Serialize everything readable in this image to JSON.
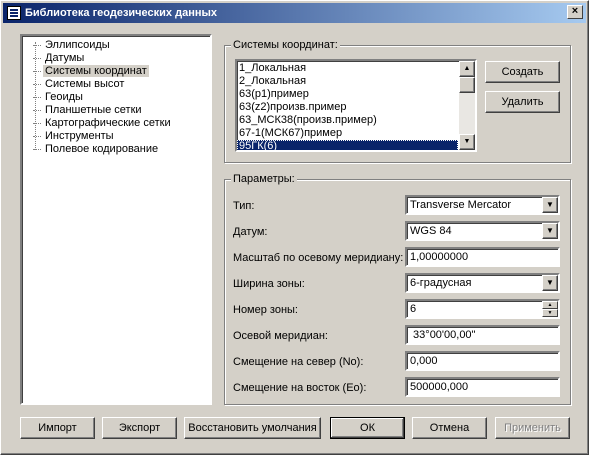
{
  "window": {
    "title": "Библиотека геодезических данных",
    "close_glyph": "×"
  },
  "tree": {
    "items": [
      {
        "label": "Эллипсоиды"
      },
      {
        "label": "Датумы"
      },
      {
        "label": "Системы координат",
        "selected": true
      },
      {
        "label": "Системы высот"
      },
      {
        "label": "Геоиды"
      },
      {
        "label": "Планшетные сетки"
      },
      {
        "label": "Картографические сетки"
      },
      {
        "label": "Инструменты"
      },
      {
        "label": "Полевое кодирование"
      }
    ]
  },
  "coord_systems": {
    "label": "Системы координат:",
    "items": [
      "1_Локальная",
      "2_Локальная",
      "63(p1)пример",
      "63(z2)произв.пример",
      "63_МСК38(произв.пример)",
      "67-1(МСК67)пример",
      "95ГК(6)"
    ],
    "selected_index": 6,
    "create_label": "Создать",
    "delete_label": "Удалить"
  },
  "params": {
    "label": "Параметры:",
    "type_label": "Тип:",
    "type_value": "Transverse Mercator",
    "datum_label": "Датум:",
    "datum_value": "WGS 84",
    "scale_label": "Масштаб по осевому меридиану:",
    "scale_value": "1,00000000",
    "zone_width_label": "Ширина зоны:",
    "zone_width_value": "6-градусная",
    "zone_number_label": "Номер зоны:",
    "zone_number_value": "6",
    "central_meridian_label": "Осевой меридиан:",
    "central_meridian_value": " 33°00'00,00\"",
    "false_northing_label": "Смещение на север (No):",
    "false_northing_value": "0,000",
    "false_easting_label": "Смещение на восток (Eo):",
    "false_easting_value": "500000,000"
  },
  "footer": {
    "import_label": "Импорт",
    "export_label": "Экспорт",
    "restore_label": "Восстановить умолчания",
    "ok_label": "ОК",
    "cancel_label": "Отмена",
    "apply_label": "Применить"
  },
  "icons": {
    "scroll_up": "▲",
    "scroll_down": "▼",
    "combo_arrow": "▼",
    "spin_up": "▲",
    "spin_down": "▼"
  }
}
